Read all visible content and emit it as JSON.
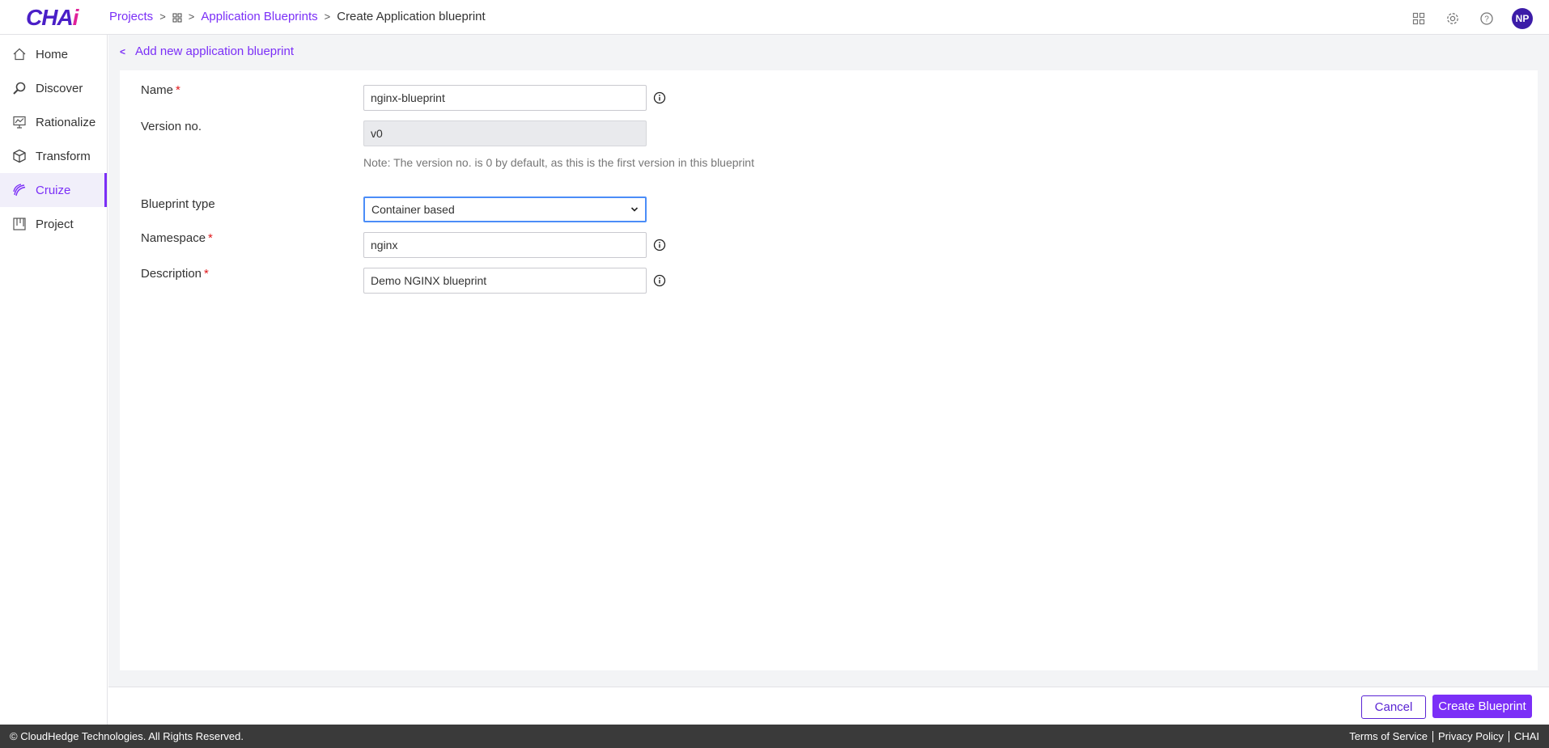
{
  "brand": {
    "logo_main": "CHA",
    "logo_accent": "i"
  },
  "breadcrumb": {
    "projects": "Projects",
    "app_blueprints": "Application Blueprints",
    "current": "Create Application blueprint"
  },
  "header": {
    "avatar_initials": "NP"
  },
  "sidebar": {
    "items": [
      {
        "label": "Home",
        "icon": "home-icon"
      },
      {
        "label": "Discover",
        "icon": "discover-icon"
      },
      {
        "label": "Rationalize",
        "icon": "rationalize-icon"
      },
      {
        "label": "Transform",
        "icon": "transform-icon"
      },
      {
        "label": "Cruize",
        "icon": "cruize-icon",
        "active": true
      },
      {
        "label": "Project",
        "icon": "project-icon"
      }
    ]
  },
  "page": {
    "back_label": "Add new application blueprint"
  },
  "form": {
    "name_label": "Name",
    "name_value": "nginx-blueprint",
    "version_label": "Version no.",
    "version_value": "v0",
    "version_note": "Note: The version no. is 0 by default, as this is the first version in this blueprint",
    "type_label": "Blueprint type",
    "type_value": "Container based",
    "namespace_label": "Namespace",
    "namespace_value": "nginx",
    "description_label": "Description",
    "description_value": "Demo NGINX blueprint",
    "required_mark": "*"
  },
  "actions": {
    "cancel": "Cancel",
    "create": "Create Blueprint"
  },
  "footer": {
    "copyright": "© CloudHedge Technologies. All Rights Reserved.",
    "terms": "Terms of Service",
    "privacy": "Privacy Policy",
    "brand": "CHAI"
  },
  "colors": {
    "accent": "#7b2ff7",
    "brand_dark": "#4a1fc7",
    "brand_pink": "#e0209a",
    "footer_bg": "#3a3a3a"
  }
}
